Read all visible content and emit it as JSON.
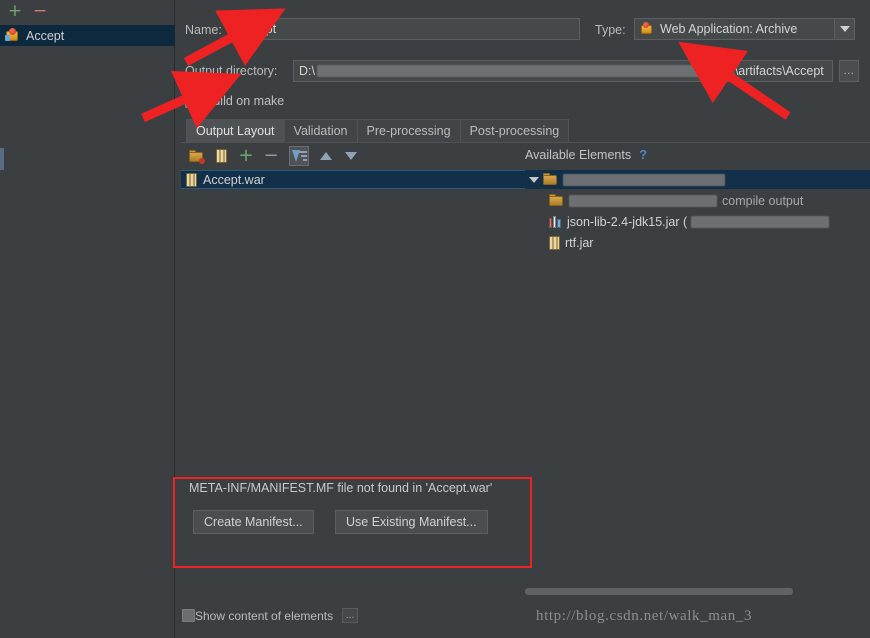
{
  "sidebar": {
    "add_button": "+",
    "remove_button": "−",
    "items": [
      {
        "label": "Accept",
        "icon": "artifact-icon",
        "selected": true
      }
    ]
  },
  "form": {
    "name_label": "Name:",
    "name_value": "Accept",
    "type_label": "Type:",
    "type_value": "Web Application: Archive",
    "type_icon": "web-application-archive-icon",
    "output_dir_label": "Output directory:",
    "output_dir_prefix": "D:\\",
    "output_dir_suffix": "\\out\\artifacts\\Accept",
    "browse_button": "...",
    "build_on_make_label": "Build on make",
    "build_on_make_checked": false
  },
  "tabs": [
    {
      "label": "Output Layout",
      "active": true
    },
    {
      "label": "Validation",
      "active": false
    },
    {
      "label": "Pre-processing",
      "active": false
    },
    {
      "label": "Post-processing",
      "active": false
    }
  ],
  "toolbar": {
    "buttons": [
      {
        "name": "create-directory-icon",
        "title": "Create Directory"
      },
      {
        "name": "create-archive-icon",
        "title": "Create Archive"
      },
      {
        "name": "add-copy-of-icon",
        "title": "Add Copy of"
      },
      {
        "name": "remove-icon",
        "title": "Remove"
      },
      {
        "name": "sort-icon",
        "title": "Sort",
        "selected": true
      },
      {
        "name": "move-up-icon",
        "title": "Move Up"
      },
      {
        "name": "move-down-icon",
        "title": "Move Down"
      }
    ]
  },
  "output_layout_tree": {
    "rows": [
      {
        "label": "Accept.war",
        "icon": "jar-icon",
        "selected": true
      }
    ]
  },
  "available_elements": {
    "header": "Available Elements",
    "help_icon": "?",
    "rows": [
      {
        "label": "",
        "icon": "module-folder-icon",
        "indent": 0,
        "expanded": true,
        "selected": true,
        "redacted": true
      },
      {
        "label": "",
        "trailing": "compile output",
        "icon": "module-folder-icon",
        "indent": 1,
        "redacted": true
      },
      {
        "label": "json-lib-2.4-jdk15.jar (",
        "icon": "library-jar-icon",
        "indent": 1,
        "redacted_tail": true
      },
      {
        "label": "rtf.jar",
        "icon": "jar-icon",
        "indent": 1
      }
    ]
  },
  "manifest": {
    "message": "META-INF/MANIFEST.MF file not found in 'Accept.war'",
    "create_button": "Create Manifest...",
    "use_existing_button": "Use Existing Manifest..."
  },
  "bottom": {
    "show_content_label": "Show content of elements",
    "show_content_checked": false,
    "dots_button": "..."
  },
  "watermark": "http://blog.csdn.net/walk_man_3",
  "colors": {
    "background": "#3c3f41",
    "selection": "#123049",
    "sidebar_selection": "#0d293e",
    "accent_red": "#ee2222",
    "text": "#bbbbbb",
    "green_plus": "#6ea96e",
    "red_minus": "#c97a7a",
    "link_blue": "#4a88c7"
  }
}
